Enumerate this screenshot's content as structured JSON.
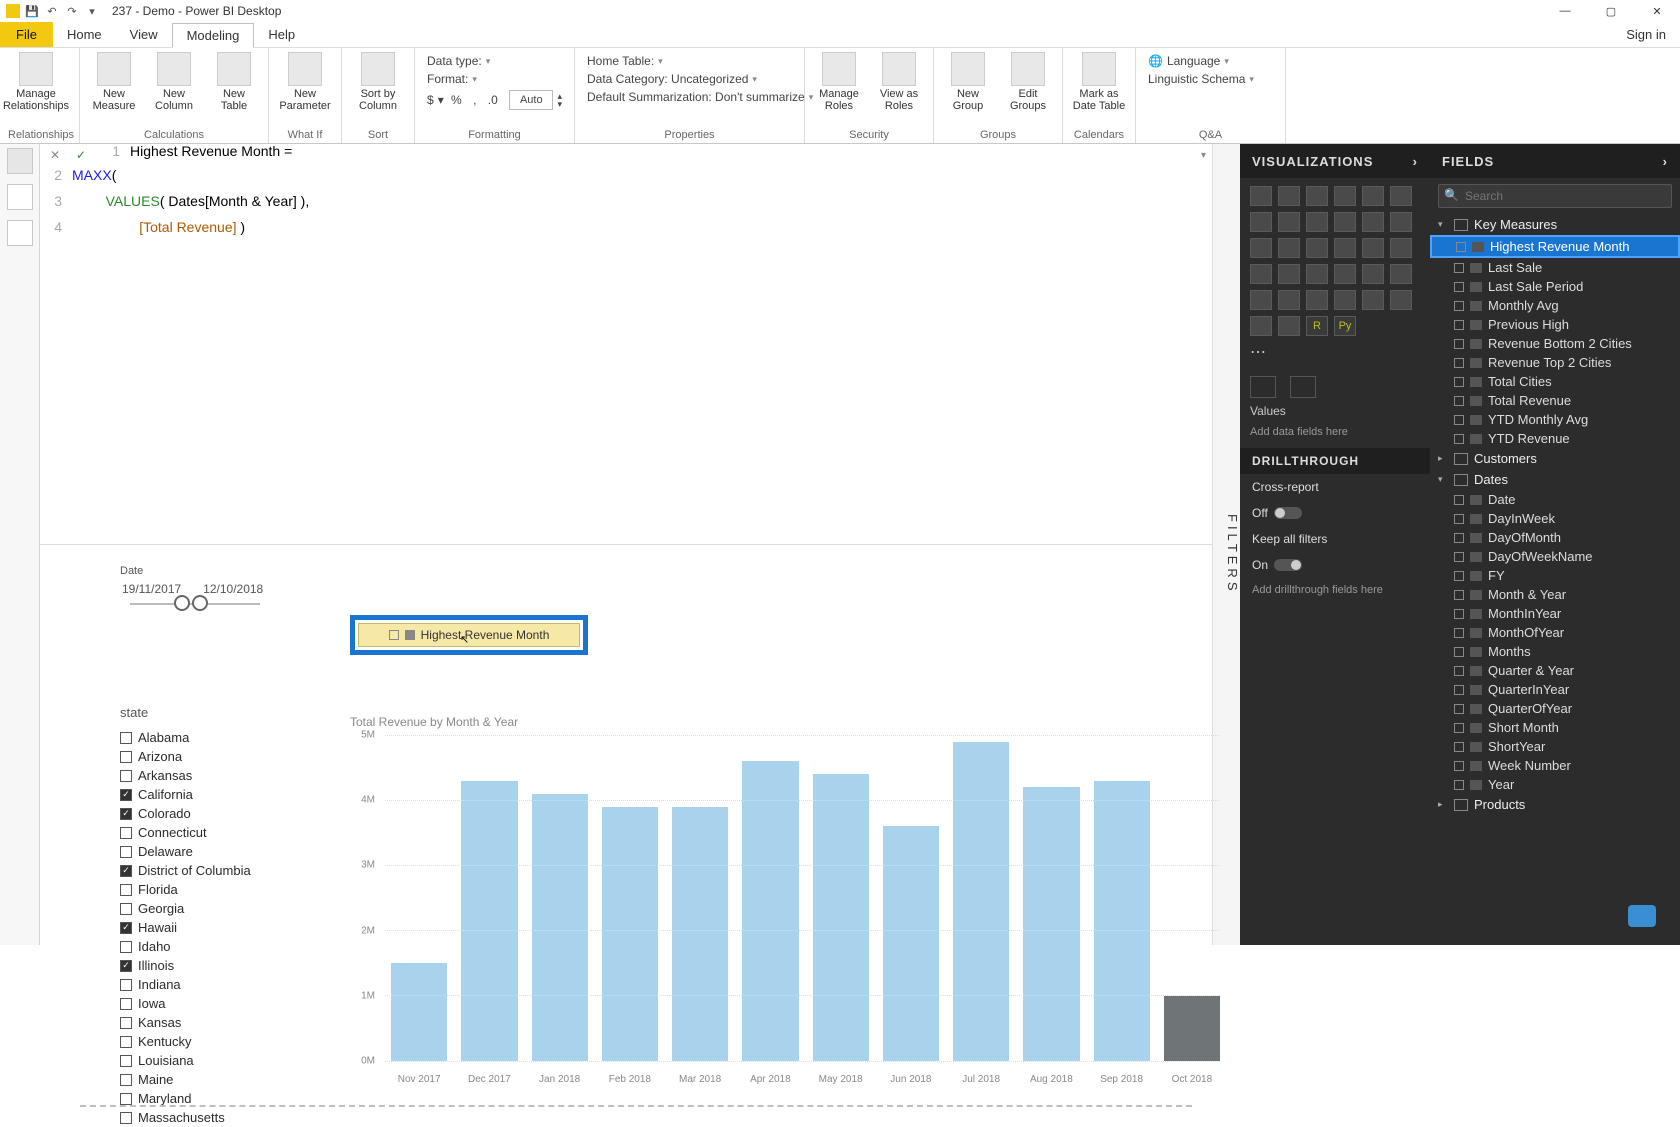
{
  "title_bar": {
    "app_title": "237 - Demo - Power BI Desktop"
  },
  "window": {
    "signin": "Sign in"
  },
  "menu": {
    "file": "File",
    "tabs": [
      "Home",
      "View",
      "Modeling",
      "Help"
    ],
    "active_index": 2
  },
  "ribbon": {
    "calculations": {
      "label": "Calculations",
      "items": [
        "Manage\nRelationships",
        "New\nMeasure",
        "New\nColumn",
        "New\nTable"
      ],
      "rel_label": "Relationships"
    },
    "whatif": {
      "label": "What If",
      "item": "New\nParameter"
    },
    "sort": {
      "label": "Sort",
      "item": "Sort by\nColumn"
    },
    "formatting": {
      "label": "Formatting",
      "datatype": "Data type:",
      "format": "Format:",
      "currency": "$",
      "percent": "%",
      "comma": ",",
      "dec": ".0",
      "auto": "Auto"
    },
    "properties": {
      "label": "Properties",
      "hometable": "Home Table:",
      "datacat": "Data Category: Uncategorized",
      "defsum": "Default Summarization: Don't summarize"
    },
    "security": {
      "label": "Security",
      "items": [
        "Manage\nRoles",
        "View as\nRoles"
      ]
    },
    "groups": {
      "label": "Groups",
      "items": [
        "New\nGroup",
        "Edit\nGroups"
      ]
    },
    "calendars": {
      "label": "Calendars",
      "item": "Mark as\nDate Table"
    },
    "qa": {
      "label": "Q&A",
      "lang": "Language",
      "ling": "Linguistic Schema"
    }
  },
  "formula": {
    "l1": "Highest Revenue Month =",
    "l2_fn": "MAXX",
    "l2_rest": "(",
    "l3_fn": "VALUES",
    "l3_rest": "( Dates[Month & Year] ),",
    "l4_lit": "[Total Revenue]",
    "l4_rest": " )"
  },
  "date_slicer": {
    "label": "Date",
    "from": "19/11/2017",
    "to": "12/10/2018"
  },
  "card": {
    "title": "Highest Revenue Month"
  },
  "state_slicer": {
    "label": "state",
    "items": [
      {
        "name": "Alabama",
        "checked": false
      },
      {
        "name": "Arizona",
        "checked": false
      },
      {
        "name": "Arkansas",
        "checked": false
      },
      {
        "name": "California",
        "checked": true
      },
      {
        "name": "Colorado",
        "checked": true
      },
      {
        "name": "Connecticut",
        "checked": false
      },
      {
        "name": "Delaware",
        "checked": false
      },
      {
        "name": "District of Columbia",
        "checked": true
      },
      {
        "name": "Florida",
        "checked": false
      },
      {
        "name": "Georgia",
        "checked": false
      },
      {
        "name": "Hawaii",
        "checked": true
      },
      {
        "name": "Idaho",
        "checked": false
      },
      {
        "name": "Illinois",
        "checked": true
      },
      {
        "name": "Indiana",
        "checked": false
      },
      {
        "name": "Iowa",
        "checked": false
      },
      {
        "name": "Kansas",
        "checked": false
      },
      {
        "name": "Kentucky",
        "checked": false
      },
      {
        "name": "Louisiana",
        "checked": false
      },
      {
        "name": "Maine",
        "checked": false
      },
      {
        "name": "Maryland",
        "checked": false
      },
      {
        "name": "Massachusetts",
        "checked": false
      }
    ]
  },
  "chart_data": {
    "type": "bar",
    "title": "Total Revenue by Month & Year",
    "ylabel": "",
    "ylim": [
      0,
      5000000
    ],
    "y_ticks": [
      "5M",
      "4M",
      "3M",
      "2M",
      "1M",
      "0M"
    ],
    "categories": [
      "Nov 2017",
      "Dec 2017",
      "Jan 2018",
      "Feb 2018",
      "Mar 2018",
      "Apr 2018",
      "May 2018",
      "Jun 2018",
      "Jul 2018",
      "Aug 2018",
      "Sep 2018",
      "Oct 2018"
    ],
    "values": [
      1500000,
      4300000,
      4100000,
      3900000,
      3900000,
      4600000,
      4400000,
      3600000,
      4900000,
      4200000,
      4300000,
      1000000
    ],
    "highlight_index": 11
  },
  "filters_tab": "FILTERS",
  "viz_pane": {
    "title": "VISUALIZATIONS",
    "values_label": "Values",
    "values_drop": "Add data fields here",
    "drill_title": "DRILLTHROUGH",
    "cross": "Cross-report",
    "cross_state": "Off",
    "keep": "Keep all filters",
    "keep_state": "On",
    "drill_drop": "Add drillthrough fields here"
  },
  "fields_pane": {
    "title": "FIELDS",
    "search_ph": "Search",
    "tables": [
      {
        "name": "Key Measures",
        "expanded": true,
        "fields": [
          {
            "name": "Highest Revenue Month",
            "selected": true
          },
          {
            "name": "Last Sale"
          },
          {
            "name": "Last Sale Period"
          },
          {
            "name": "Monthly Avg"
          },
          {
            "name": "Previous High"
          },
          {
            "name": "Revenue Bottom 2 Cities"
          },
          {
            "name": "Revenue Top 2 Cities"
          },
          {
            "name": "Total Cities"
          },
          {
            "name": "Total Revenue"
          },
          {
            "name": "YTD Monthly Avg"
          },
          {
            "name": "YTD Revenue"
          }
        ]
      },
      {
        "name": "Customers",
        "expanded": false
      },
      {
        "name": "Dates",
        "expanded": true,
        "fields": [
          {
            "name": "Date"
          },
          {
            "name": "DayInWeek"
          },
          {
            "name": "DayOfMonth"
          },
          {
            "name": "DayOfWeekName"
          },
          {
            "name": "FY"
          },
          {
            "name": "Month & Year"
          },
          {
            "name": "MonthInYear"
          },
          {
            "name": "MonthOfYear"
          },
          {
            "name": "Months"
          },
          {
            "name": "Quarter & Year"
          },
          {
            "name": "QuarterInYear"
          },
          {
            "name": "QuarterOfYear"
          },
          {
            "name": "Short Month"
          },
          {
            "name": "ShortYear"
          },
          {
            "name": "Week Number"
          },
          {
            "name": "Year"
          }
        ]
      },
      {
        "name": "Products",
        "expanded": false
      }
    ]
  }
}
